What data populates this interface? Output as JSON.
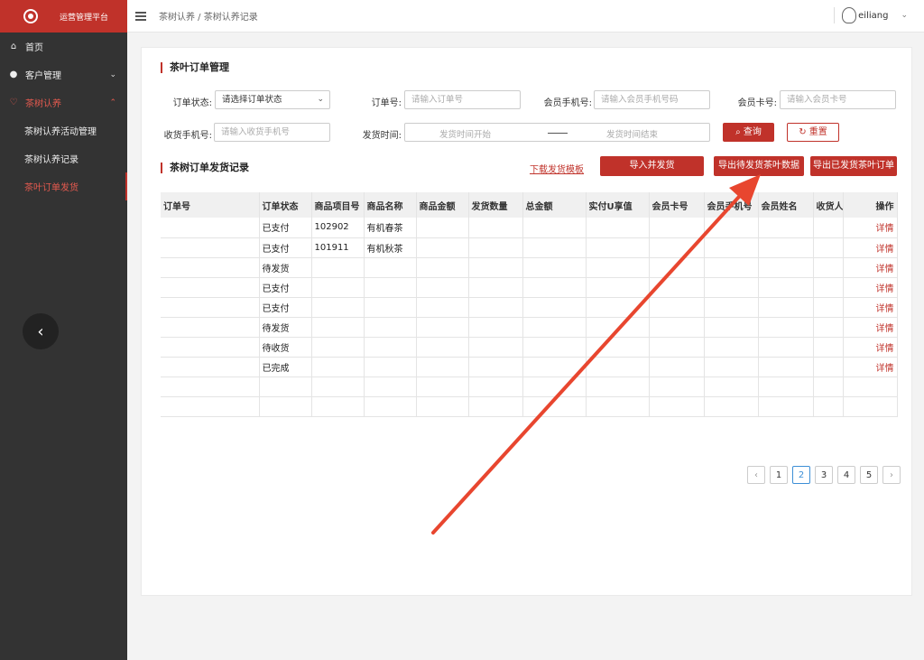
{
  "app": {
    "title": "运营管理平台"
  },
  "sidebar": {
    "items": [
      {
        "label": "首页",
        "icon": "home-icon"
      },
      {
        "label": "客户管理",
        "icon": "user-icon"
      },
      {
        "label": "茶树认养",
        "icon": "heart-icon"
      }
    ],
    "sub_items": [
      {
        "label": "茶树认养活动管理"
      },
      {
        "label": "茶树认养记录"
      },
      {
        "label": "茶叶订单发货"
      }
    ],
    "collapse_glyph": "‹"
  },
  "header": {
    "breadcrumb": "茶树认养 / 茶树认养记录",
    "username": "eiliang"
  },
  "filters": {
    "title": "茶叶订单管理",
    "order_status_label": "订单状态:",
    "order_status_value": "请选择订单状态",
    "order_no_label": "订单号:",
    "order_no_placeholder": "请输入订单号",
    "member_phone_label": "会员手机号:",
    "member_phone_placeholder": "请输入会员手机号码",
    "member_card_label": "会员卡号:",
    "member_card_placeholder": "请输入会员卡号",
    "receiver_phone_label": "收货手机号:",
    "receiver_phone_placeholder": "请输入收货手机号",
    "ship_time_label": "发货时间:",
    "ship_start_placeholder": "发货时间开始",
    "ship_end_placeholder": "发货时间结束",
    "query_label": "查询",
    "reset_label": "重置"
  },
  "records": {
    "title": "茶树订单发货记录",
    "download_template": "下载发货模板",
    "import_ship": "导入并发货",
    "export_pending": "导出待发货茶叶数据",
    "export_shipped": "导出已发货茶叶订单"
  },
  "table": {
    "headers": [
      "订单号",
      "订单状态",
      "商品项目号",
      "商品名称",
      "商品金额",
      "发货数量",
      "总金额",
      "实付U享值",
      "会员卡号",
      "会员手机号",
      "会员姓名",
      "收货人",
      "操作"
    ],
    "rows": [
      [
        "",
        "已支付",
        "102902",
        "有机春茶",
        "",
        "",
        "",
        "",
        "",
        "",
        "",
        "",
        "详情"
      ],
      [
        "",
        "已支付",
        "101911",
        "有机秋茶",
        "",
        "",
        "",
        "",
        "",
        "",
        "",
        "",
        "详情"
      ],
      [
        "",
        "待发货",
        "",
        "",
        "",
        "",
        "",
        "",
        "",
        "",
        "",
        "",
        "详情"
      ],
      [
        "",
        "已支付",
        "",
        "",
        "",
        "",
        "",
        "",
        "",
        "",
        "",
        "",
        "详情"
      ],
      [
        "",
        "已支付",
        "",
        "",
        "",
        "",
        "",
        "",
        "",
        "",
        "",
        "",
        "详情"
      ],
      [
        "",
        "待发货",
        "",
        "",
        "",
        "",
        "",
        "",
        "",
        "",
        "",
        "",
        "详情"
      ],
      [
        "",
        "待收货",
        "",
        "",
        "",
        "",
        "",
        "",
        "",
        "",
        "",
        "",
        "详情"
      ],
      [
        "",
        "已完成",
        "",
        "",
        "",
        "",
        "",
        "",
        "",
        "",
        "",
        "",
        "详情"
      ],
      [
        "",
        "",
        "",
        "",
        "",
        "",
        "",
        "",
        "",
        "",
        "",
        "",
        ""
      ],
      [
        "",
        "",
        "",
        "",
        "",
        "",
        "",
        "",
        "",
        "",
        "",
        "",
        ""
      ]
    ]
  },
  "pagination": {
    "prev": "‹",
    "next": "›",
    "pages": [
      "1",
      "2",
      "3",
      "4",
      "5"
    ],
    "current": "2"
  },
  "colors": {
    "brand": "#c0322a",
    "sidebar": "#333333",
    "annotation_arrow": "#e8462f"
  }
}
